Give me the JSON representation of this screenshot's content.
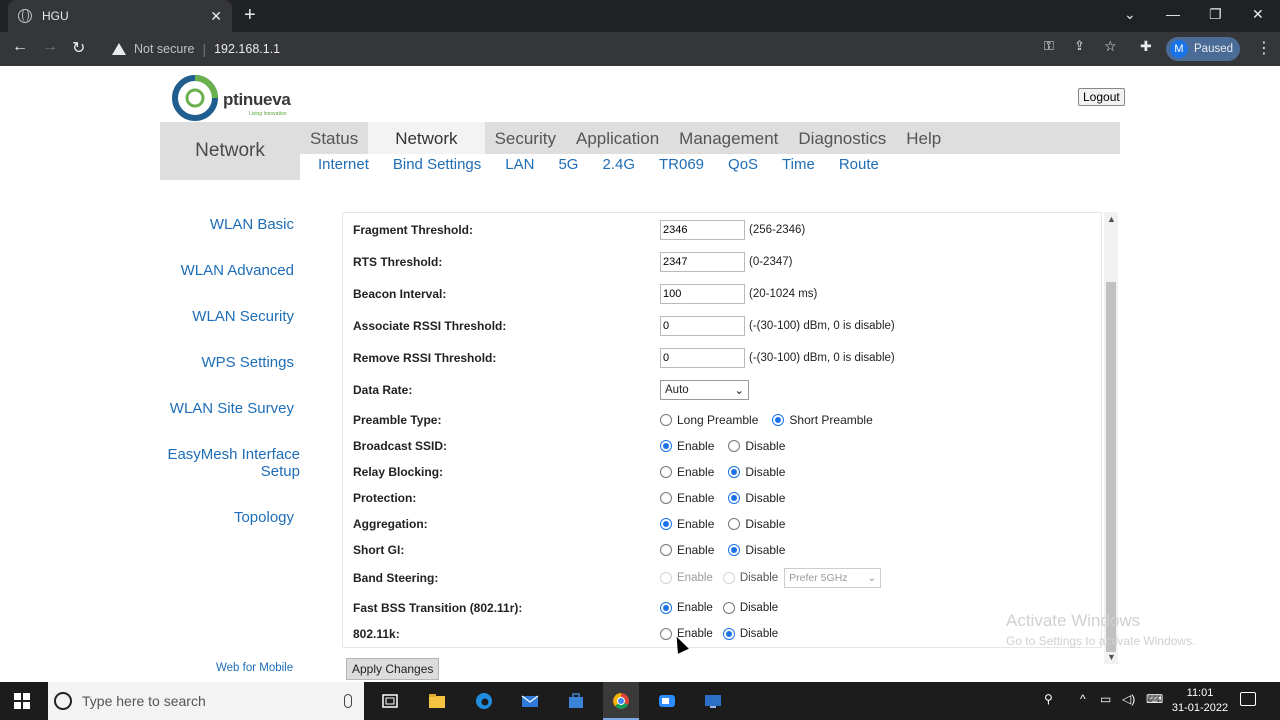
{
  "browser": {
    "tab_title": "HGU",
    "not_secure": "Not secure",
    "url": "192.168.1.1",
    "profile_initial": "M",
    "profile_status": "Paused"
  },
  "header": {
    "logo_text": "ptinueva",
    "logo_sub": "Living Innovation",
    "logout": "Logout"
  },
  "nav": {
    "section_label": "Network",
    "menu": [
      "Status",
      "Network",
      "Security",
      "Application",
      "Management",
      "Diagnostics",
      "Help"
    ],
    "active_menu": "Network",
    "submenu": [
      "Internet",
      "Bind Settings",
      "LAN",
      "5G",
      "2.4G",
      "TR069",
      "QoS",
      "Time",
      "Route"
    ]
  },
  "sidebar": {
    "items": [
      "WLAN Basic",
      "WLAN Advanced",
      "WLAN Security",
      "WPS Settings",
      "WLAN Site Survey",
      "EasyMesh Interface Setup",
      "Topology"
    ],
    "footer_link": "Web for Mobile"
  },
  "form": {
    "fragment_threshold": {
      "label": "Fragment Threshold:",
      "value": "2346",
      "hint": "(256-2346)"
    },
    "rts_threshold": {
      "label": "RTS Threshold:",
      "value": "2347",
      "hint": "(0-2347)"
    },
    "beacon_interval": {
      "label": "Beacon Interval:",
      "value": "100",
      "hint": "(20-1024 ms)"
    },
    "assoc_rssi": {
      "label": "Associate RSSI Threshold:",
      "value": "0",
      "hint": "(-(30-100) dBm, 0 is disable)"
    },
    "remove_rssi": {
      "label": "Remove RSSI Threshold:",
      "value": "0",
      "hint": "(-(30-100) dBm, 0 is disable)"
    },
    "data_rate": {
      "label": "Data Rate:",
      "value": "Auto"
    },
    "preamble": {
      "label": "Preamble Type:",
      "opt1": "Long Preamble",
      "opt2": "Short Preamble"
    },
    "broadcast_ssid": {
      "label": "Broadcast SSID:"
    },
    "relay_blocking": {
      "label": "Relay Blocking:"
    },
    "protection": {
      "label": "Protection:"
    },
    "aggregation": {
      "label": "Aggregation:"
    },
    "short_gi": {
      "label": "Short GI:"
    },
    "band_steering": {
      "label": "Band Steering:",
      "select": "Prefer 5GHz"
    },
    "fast_bss": {
      "label": "Fast BSS Transition (802.11r):"
    },
    "dot11k": {
      "label": "802.11k:"
    },
    "enable": "Enable",
    "disable": "Disable",
    "apply": "Apply Changes"
  },
  "watermark": {
    "line1": "Activate Windows",
    "line2": "Go to Settings to activate Windows."
  },
  "taskbar": {
    "search_placeholder": "Type here to search",
    "time": "11:01",
    "date": "31-01-2022"
  },
  "colors": {
    "link": "#1e6db7",
    "nav_bg": "#dedede",
    "radio_on": "#1a73e8"
  }
}
